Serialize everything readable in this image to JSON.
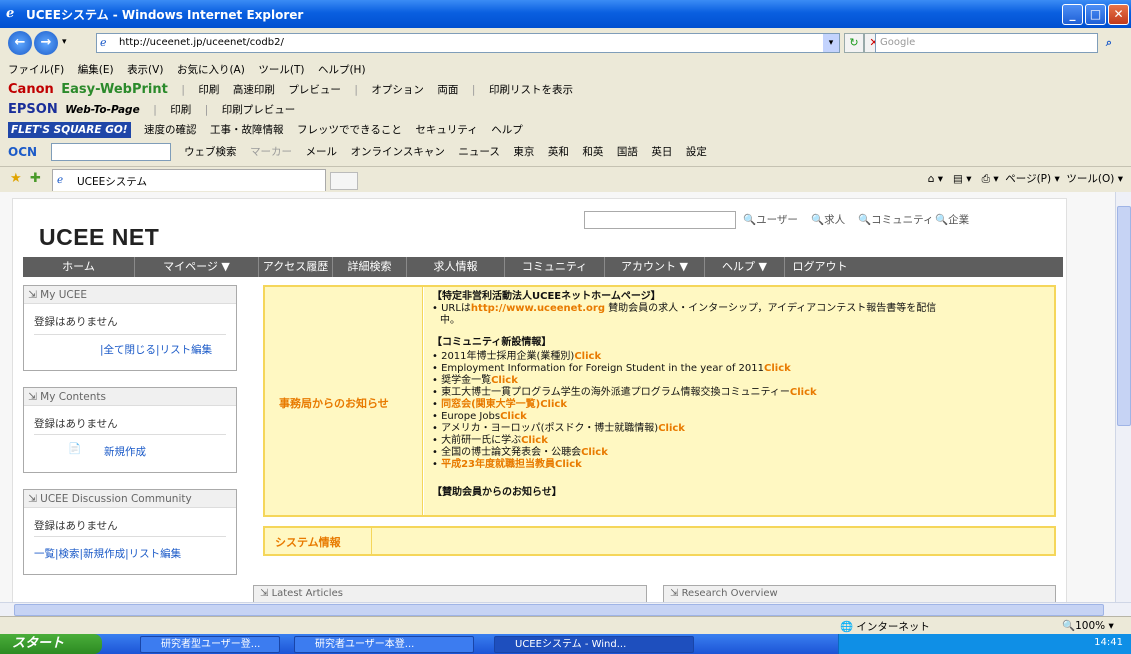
{
  "window": {
    "title": "UCEEシステム - Windows Internet Explorer"
  },
  "addressbar": {
    "url": "http://uceenet.jp/uceenet/codb2/",
    "search_placeholder": "Google"
  },
  "menu": [
    "ファイル(F)",
    "編集(E)",
    "表示(V)",
    "お気に入り(A)",
    "ツール(T)",
    "ヘルプ(H)"
  ],
  "toolbar_canon": {
    "brand": "Canon",
    "sub": "Easy-WebPrint",
    "items": [
      "印刷",
      "高速印刷",
      "プレビュー",
      "オプション",
      "両面",
      "印刷リストを表示"
    ]
  },
  "toolbar_epson": {
    "brand": "EPSON",
    "sub": "Web-To-Page",
    "items": [
      "印刷",
      "印刷プレビュー"
    ]
  },
  "toolbar_flets": {
    "brand": "FLET'S SQUARE GO!",
    "items": [
      "速度の確認",
      "工事・故障情報",
      "フレッツでできること",
      "セキュリティ",
      "ヘルプ"
    ]
  },
  "toolbar_ocn": {
    "brand": "OCN",
    "items": [
      "ウェブ検索",
      "マーカー",
      "メール",
      "オンラインスキャン",
      "ニュース",
      "東京",
      "英和",
      "和英",
      "国語",
      "英日"
    ],
    "settings": "設定"
  },
  "tabs": {
    "current": "UCEEシステム"
  },
  "command_bar": [
    "ページ(P)",
    "ツール(O)"
  ],
  "site": {
    "logo": "UCEE NET",
    "quick_links": [
      "ユーザー",
      "求人",
      "コミュニティ",
      "企業"
    ],
    "nav": [
      "ホーム",
      "マイページ ▼",
      "アクセス履歴",
      "詳細検索",
      "求人情報",
      "コミュニティ",
      "アカウント ▼",
      "ヘルプ ▼",
      "ログアウト"
    ],
    "my_ucee": {
      "title": "My UCEE",
      "empty": "登録はありません",
      "links": "|全て閉じる|リスト編集"
    },
    "my_contents": {
      "title": "My Contents",
      "empty": "登録はありません",
      "new": "新規作成"
    },
    "discussion": {
      "title": "UCEE Discussion Community",
      "empty": "登録はありません",
      "links": "一覧|検索|新規作成|リスト編集"
    },
    "notice": {
      "label": "事務局からのお知らせ",
      "lines": [
        {
          "kind": "head",
          "text": "【特定非営利活動法人UCEEネットホームページ】"
        },
        {
          "kind": "bullet",
          "text": "URLは",
          "link": "http://www.uceenet.org",
          "tail": " 賛助会員の求人・インターシップ，アイディアコンテスト報告書等を配信"
        },
        {
          "kind": "cont",
          "text": "中。"
        },
        {
          "kind": "head",
          "text": "【コミュニティ新設情報】"
        },
        {
          "kind": "bullet",
          "text": "2011年博士採用企業(業種別)",
          "click": "Click"
        },
        {
          "kind": "bullet",
          "text": "Employment Information for Foreign Student in the year of 2011",
          "click": "Click"
        },
        {
          "kind": "bullet",
          "text": "奨学金一覧",
          "click": "Click"
        },
        {
          "kind": "bullet",
          "text": "東工大博士一貫プログラム学生の海外派遣プログラム情報交換コミュニティー",
          "click": "Click"
        },
        {
          "kind": "bullet-orange",
          "text": "同窓会(関東大学一覧)",
          "click": "Click"
        },
        {
          "kind": "bullet",
          "text": "Europe Jobs",
          "click": "Click"
        },
        {
          "kind": "bullet",
          "text": "アメリカ・ヨーロッパ(ポスドク・博士就職情報)",
          "click": "Click"
        },
        {
          "kind": "bullet",
          "text": "大前研一氏に学ぶ",
          "click": "Click"
        },
        {
          "kind": "bullet",
          "text": "全国の博士論文発表会・公聴会",
          "click": "Click"
        },
        {
          "kind": "bullet-orange",
          "text": "平成23年度就職担当教員",
          "click": "Click"
        },
        {
          "kind": "head",
          "text": "【賛助会員からのお知らせ】"
        }
      ]
    },
    "system_info": "システム情報",
    "latest_articles": "Latest Articles",
    "research_overview": "Research Overview"
  },
  "statusbar": {
    "zone": "インターネット",
    "zoom": "100%"
  },
  "taskbar": {
    "start": "スタート",
    "tasks": [
      "研究者型ユーザー登...",
      "研究者ユーザー本登...",
      "UCEEシステム - Wind..."
    ],
    "clock": "14:41"
  }
}
